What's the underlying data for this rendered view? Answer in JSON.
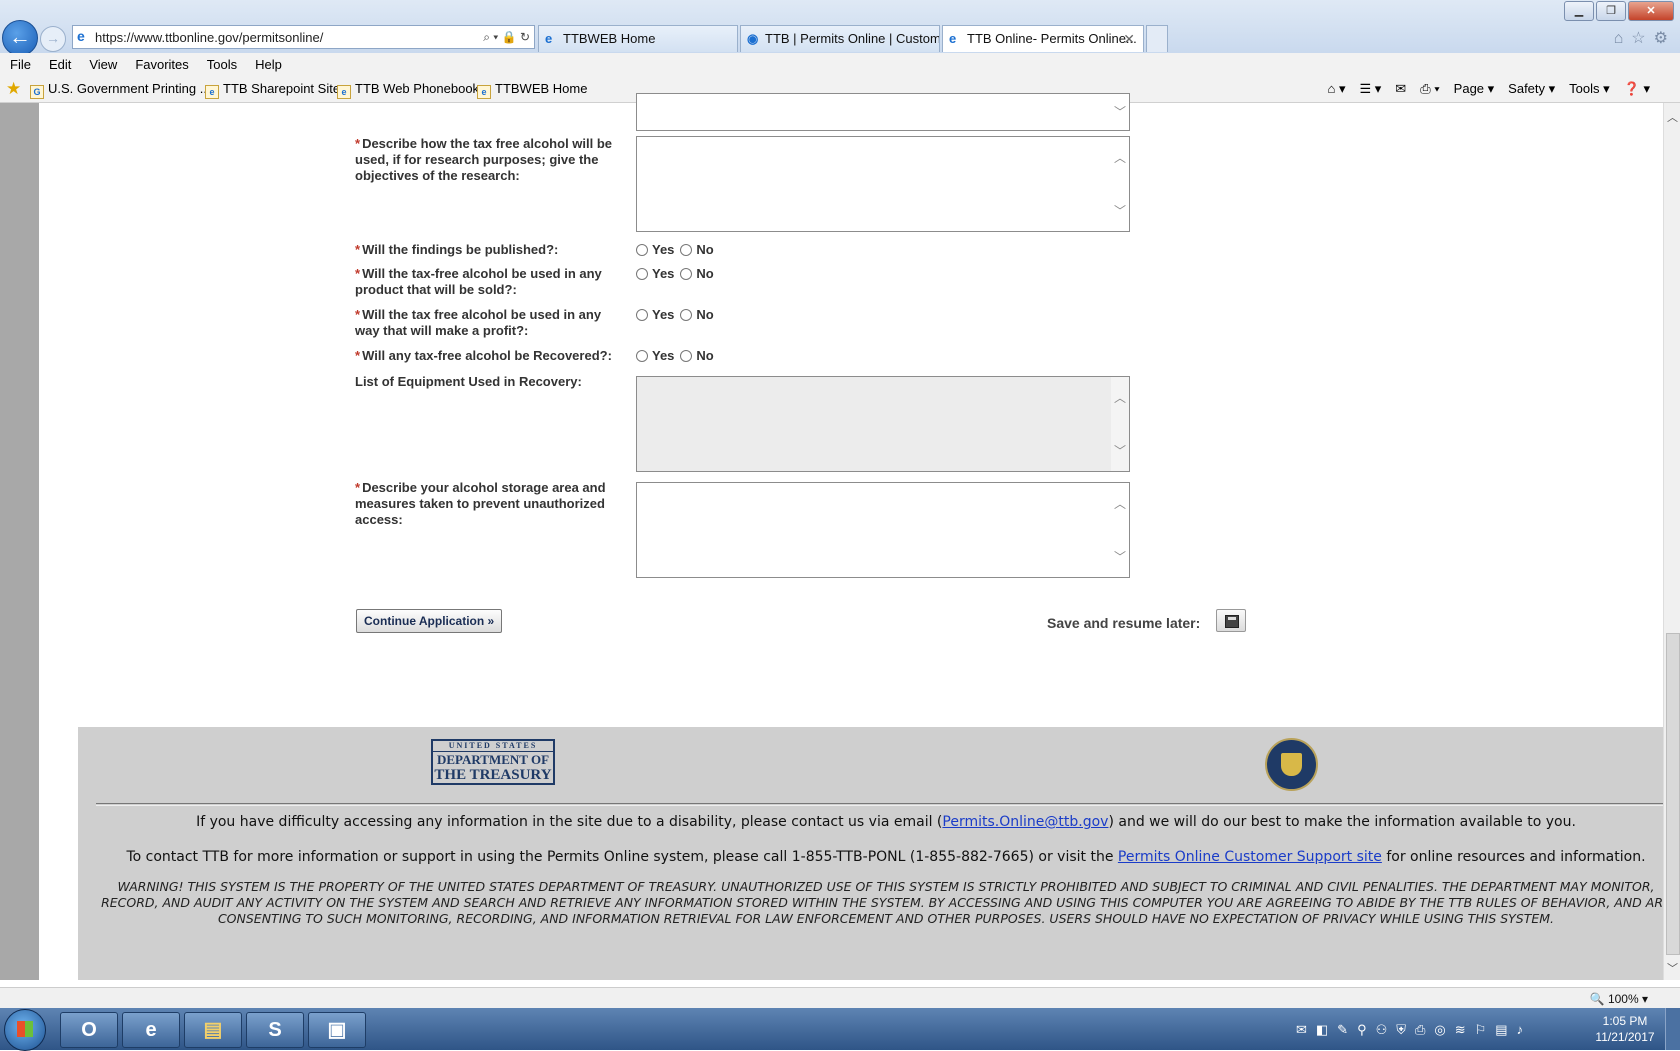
{
  "browser": {
    "address_url": "https://www.ttbonline.gov/permitsonline/",
    "tabs": [
      {
        "label": "TTBWEB Home"
      },
      {
        "label": "TTB | Permits Online | Custom..."
      },
      {
        "label": "TTB Online- Permits Online..."
      }
    ],
    "menu": [
      "File",
      "Edit",
      "View",
      "Favorites",
      "Tools",
      "Help"
    ],
    "favorites": [
      {
        "label": "U.S. Government Printing ..."
      },
      {
        "label": "TTB Sharepoint Site"
      },
      {
        "label": "TTB Web Phonebook"
      },
      {
        "label": "TTBWEB Home"
      }
    ],
    "command_bar": [
      "Page ▾",
      "Safety ▾",
      "Tools ▾"
    ],
    "zoom": "100%"
  },
  "form": {
    "q_research": "Describe how the tax free alcohol will be used, if for research purposes; give the objectives of the research:",
    "q_published": "Will the findings be published?:",
    "q_sold": "Will the tax-free alcohol be used in any product that will be sold?:",
    "q_profit": "Will the tax free alcohol be used in any way that will make a profit?:",
    "q_recovered": "Will any tax-free alcohol be Recovered?:",
    "equipment_label": "List of Equipment Used in Recovery:",
    "q_storage": "Describe your alcohol storage area and measures taken to prevent unauthorized access:",
    "yes": "Yes",
    "no": "No",
    "required_mark": "*",
    "continue_label": "Continue Application »",
    "save_label": "Save and resume later:"
  },
  "footer": {
    "treasury_top": "UNITED STATES",
    "treasury_mid": "DEPARTMENT OF",
    "treasury_bottom": "THE TREASURY",
    "access_pre": "If you have difficulty accessing any information in the site due to a disability, please contact us via email (",
    "access_email": "Permits.Online@ttb.gov",
    "access_post": ") and we will do our best to make the information available to you.",
    "contact_pre": "To contact TTB for more information or support in using the Permits Online system, please call 1-855-TTB-PONL (1-855-882-7665) or visit the ",
    "contact_link": "Permits Online Customer Support site",
    "contact_post": " for online resources and information.",
    "warning": "WARNING! THIS SYSTEM IS THE PROPERTY OF THE UNITED STATES DEPARTMENT OF TREASURY. UNAUTHORIZED USE OF THIS SYSTEM IS STRICTLY PROHIBITED AND SUBJECT TO CRIMINAL AND CIVIL PENALITIES. THE DEPARTMENT MAY MONITOR, RECORD, AND AUDIT ANY ACTIVITY ON THE SYSTEM AND SEARCH AND RETRIEVE ANY INFORMATION STORED WITHIN THE SYSTEM. BY ACCESSING AND USING THIS COMPUTER YOU ARE AGREEING TO ABIDE BY THE TTB RULES OF BEHAVIOR, AND ARE CONSENTING TO SUCH MONITORING, RECORDING, AND INFORMATION RETRIEVAL FOR LAW ENFORCEMENT AND OTHER PURPOSES. USERS SHOULD HAVE NO EXPECTATION OF PRIVACY WHILE USING THIS SYSTEM."
  },
  "taskbar": {
    "time": "1:05 PM",
    "date": "11/21/2017"
  },
  "icons": {
    "back": "back-arrow-icon",
    "forward": "forward-arrow-icon",
    "save": "floppy-disk-icon"
  }
}
